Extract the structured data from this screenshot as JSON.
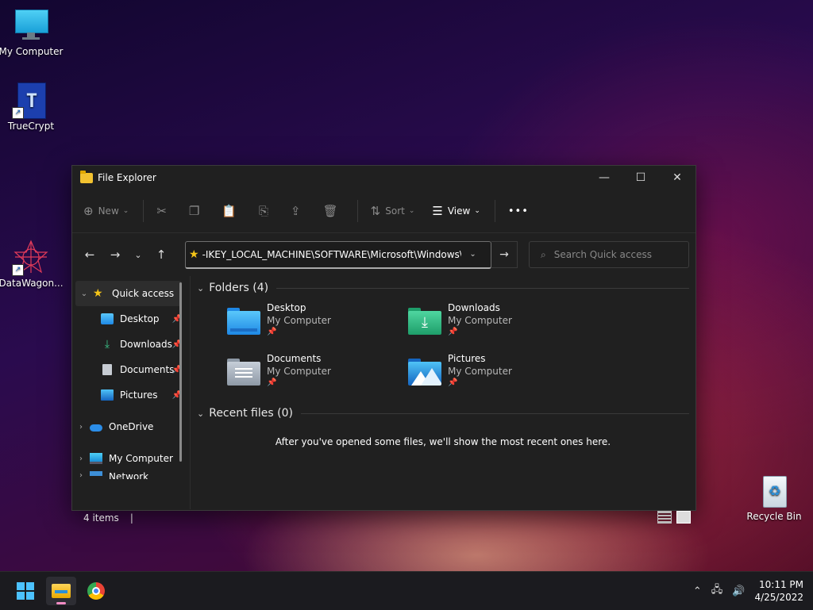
{
  "desktop": {
    "icons": [
      {
        "label": "My Computer",
        "icon": "monitor-icon"
      },
      {
        "label": "TrueCrypt",
        "icon": "truecrypt-icon"
      },
      {
        "label": "DataWagon...",
        "icon": "datawagon-icon"
      },
      {
        "label": "Recycle Bin",
        "icon": "recycle-bin-icon"
      }
    ]
  },
  "window": {
    "title": "File Explorer",
    "controls": {
      "minimize": "—",
      "maximize": "☐",
      "close": "✕"
    }
  },
  "toolbar": {
    "new_label": "New",
    "sort_label": "Sort",
    "view_label": "View",
    "more_label": "•••"
  },
  "address": {
    "path": "-IKEY_LOCAL_MACHINE\\SOFTWARE\\Microsoft\\Windows\\Cur",
    "search_placeholder": "Search Quick access"
  },
  "nav": {
    "items": [
      {
        "label": "Quick access",
        "icon": "star-icon"
      },
      {
        "label": "Desktop",
        "icon": "desktop-folder-icon"
      },
      {
        "label": "Downloads",
        "icon": "download-arrow-icon"
      },
      {
        "label": "Documents",
        "icon": "document-icon"
      },
      {
        "label": "Pictures",
        "icon": "pictures-icon"
      },
      {
        "label": "OneDrive",
        "icon": "cloud-icon"
      },
      {
        "label": "My Computer",
        "icon": "monitor-icon"
      },
      {
        "label": "Network",
        "icon": "network-icon"
      }
    ]
  },
  "content": {
    "folders_header": "Folders (4)",
    "folders": [
      {
        "name": "Desktop",
        "location": "My Computer"
      },
      {
        "name": "Downloads",
        "location": "My Computer"
      },
      {
        "name": "Documents",
        "location": "My Computer"
      },
      {
        "name": "Pictures",
        "location": "My Computer"
      }
    ],
    "recent_header": "Recent files (0)",
    "recent_empty": "After you've opened some files, we'll show the most recent ones here."
  },
  "status": {
    "count": "4 items",
    "separator": "|"
  },
  "taskbar": {
    "time": "10:11 PM",
    "date": "4/25/2022"
  },
  "colors": {
    "accent": "#0078d4",
    "folder_yellow": "#f2c230",
    "star": "#f5c518"
  }
}
